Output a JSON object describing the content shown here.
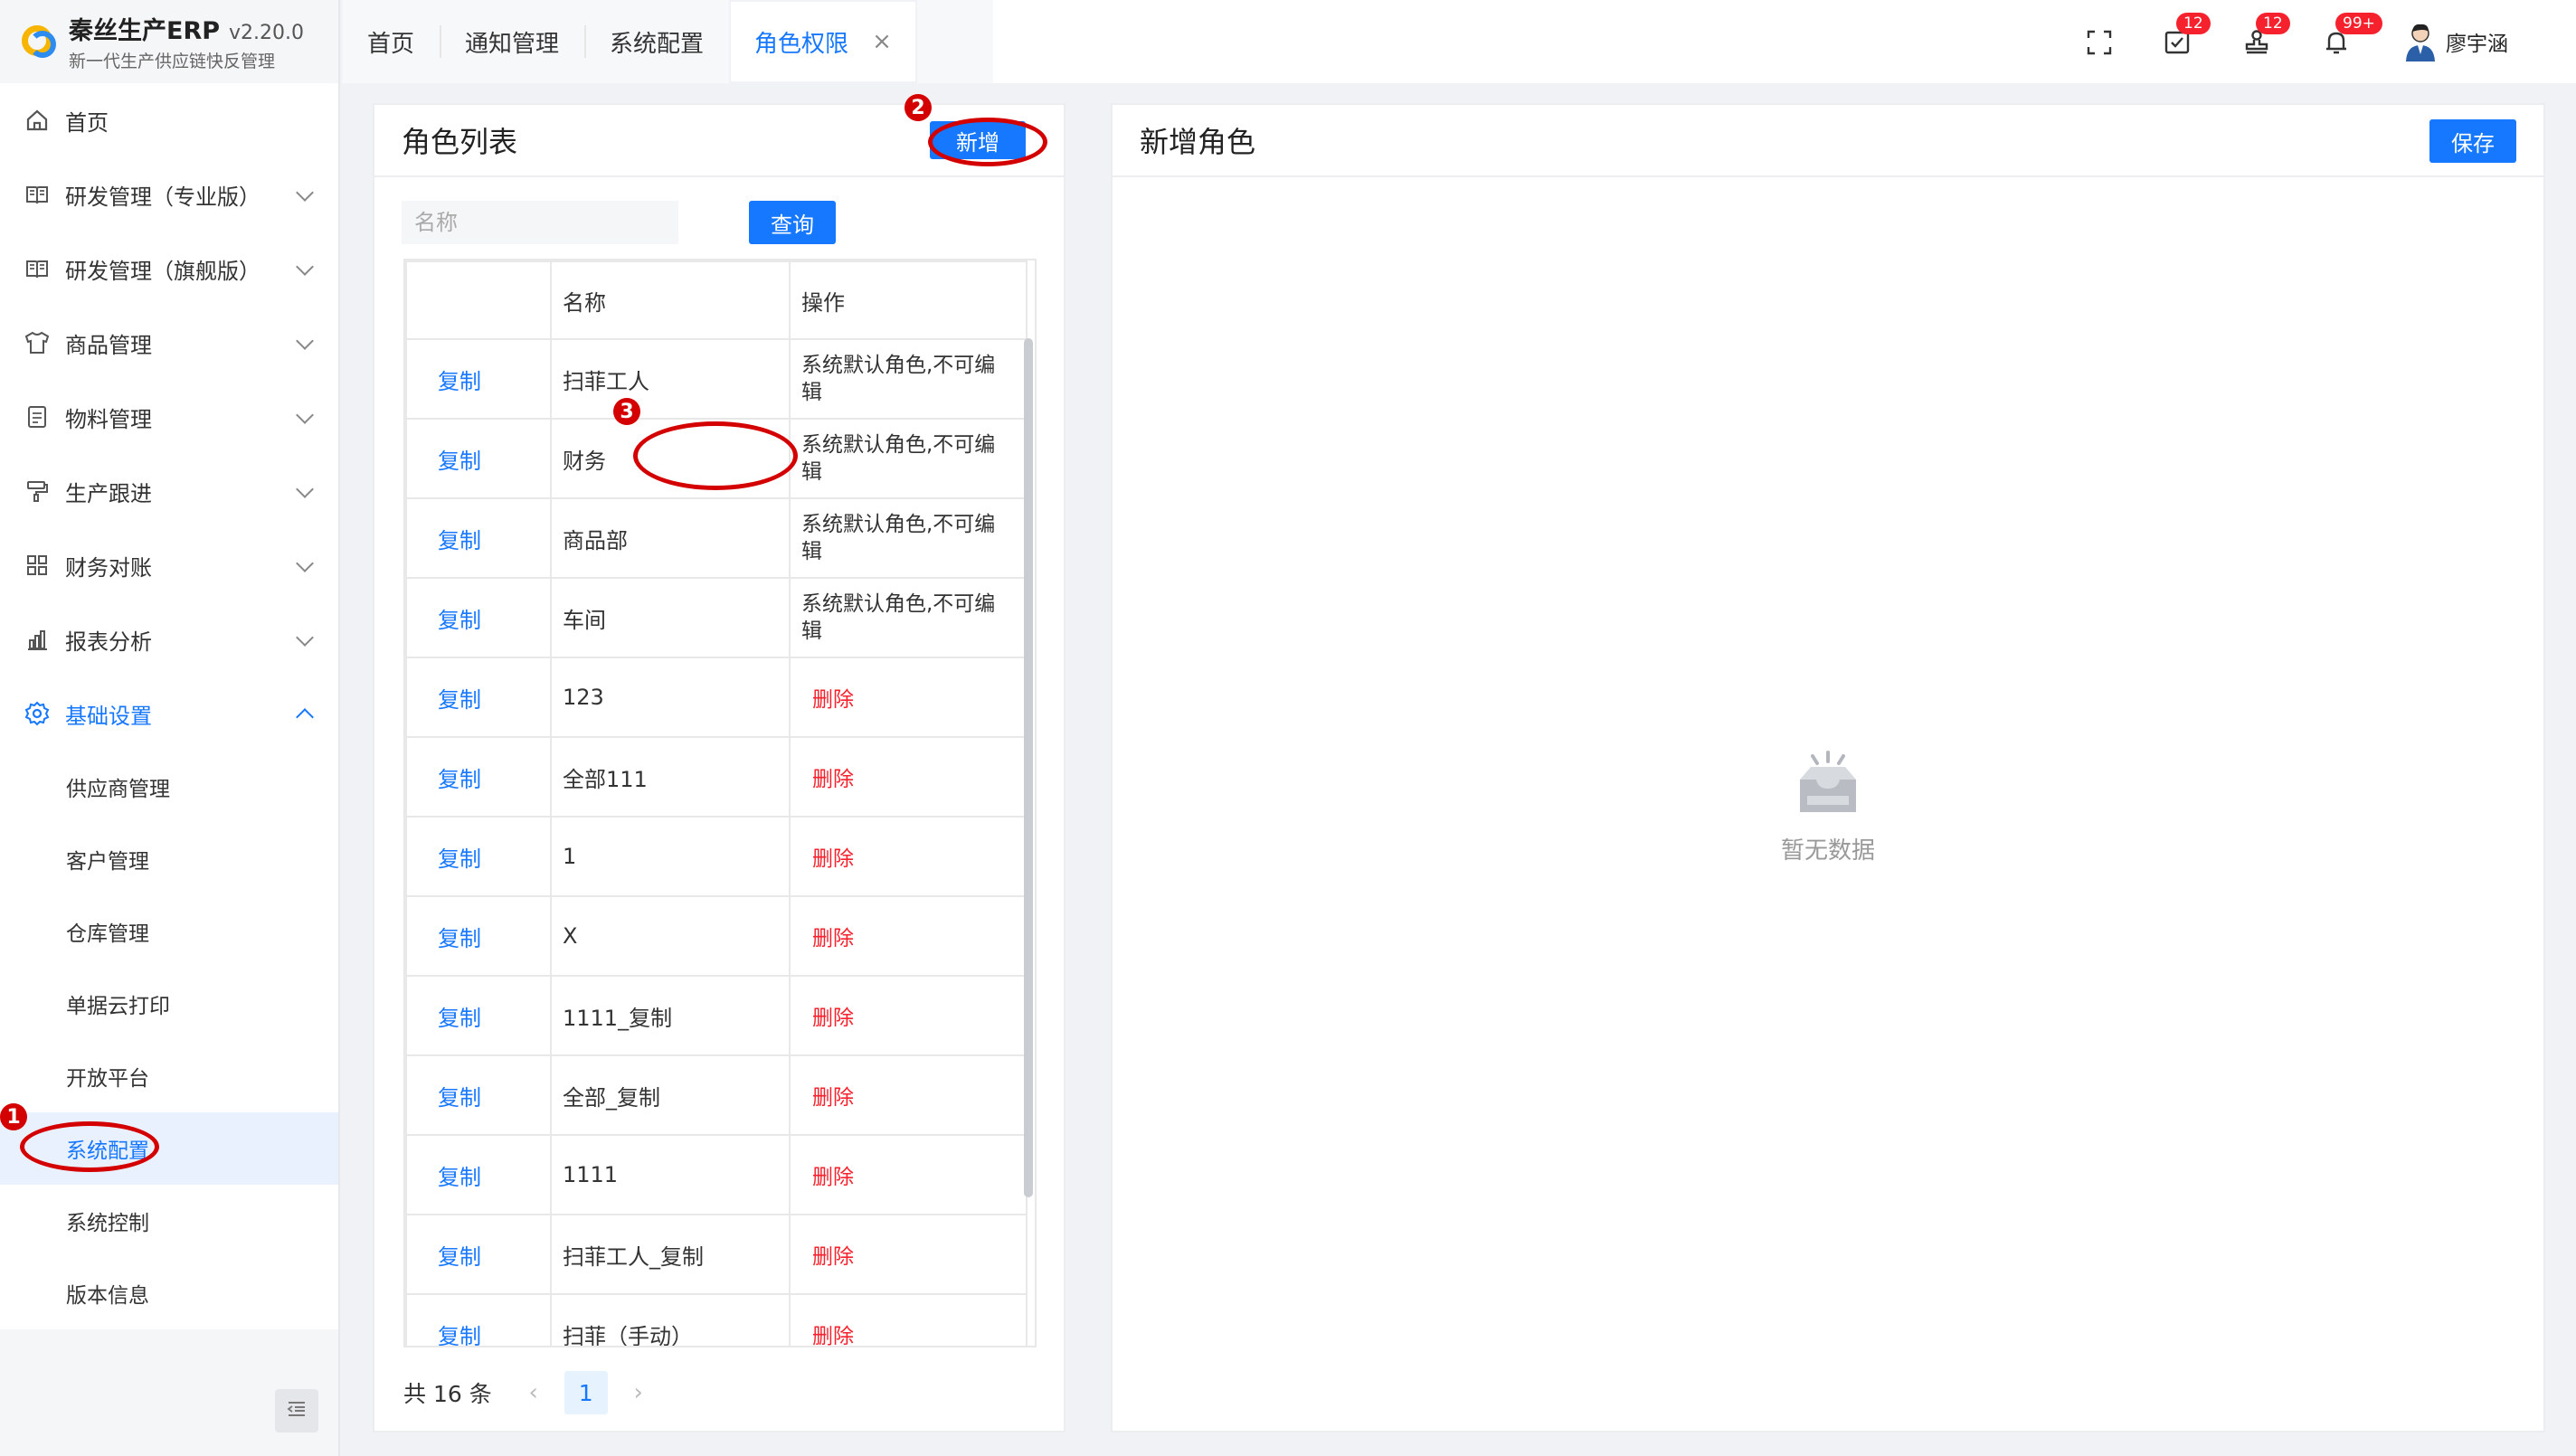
{
  "brand": {
    "name": "秦丝生产ERP",
    "version": "v2.20.0",
    "subtitle": "新一代生产供应链快反管理"
  },
  "sidebar": {
    "items": [
      {
        "label": "首页",
        "icon": "home-icon"
      },
      {
        "label": "研发管理（专业版）",
        "icon": "book-icon"
      },
      {
        "label": "研发管理（旗舰版）",
        "icon": "book-icon"
      },
      {
        "label": "商品管理",
        "icon": "shirt-icon"
      },
      {
        "label": "物料管理",
        "icon": "document-icon"
      },
      {
        "label": "生产跟进",
        "icon": "roller-icon"
      },
      {
        "label": "财务对账",
        "icon": "grid-icon"
      },
      {
        "label": "报表分析",
        "icon": "bar-chart-icon"
      },
      {
        "label": "基础设置",
        "icon": "gear-icon"
      }
    ],
    "submenu": [
      {
        "label": "供应商管理"
      },
      {
        "label": "客户管理"
      },
      {
        "label": "仓库管理"
      },
      {
        "label": "单据云打印"
      },
      {
        "label": "开放平台"
      },
      {
        "label": "系统配置"
      },
      {
        "label": "系统控制"
      },
      {
        "label": "版本信息"
      }
    ]
  },
  "tabs": [
    {
      "label": "首页"
    },
    {
      "label": "通知管理"
    },
    {
      "label": "系统配置"
    },
    {
      "label": "角色权限",
      "close": "×"
    }
  ],
  "header": {
    "badges": {
      "tasks": "12",
      "stamps": "12",
      "notifications": "99+"
    },
    "user": "廖宇涵"
  },
  "role_list": {
    "title": "角色列表",
    "add_label": "新增",
    "search_placeholder": "名称",
    "query_label": "查询",
    "columns": [
      "",
      "名称",
      "操作"
    ],
    "rows": [
      {
        "action": "复制",
        "name": "扫菲工人",
        "op": "系统默认角色,不可编辑",
        "type": "sys"
      },
      {
        "action": "复制",
        "name": "财务",
        "op": "系统默认角色,不可编辑",
        "type": "sys"
      },
      {
        "action": "复制",
        "name": "商品部",
        "op": "系统默认角色,不可编辑",
        "type": "sys"
      },
      {
        "action": "复制",
        "name": "车间",
        "op": "系统默认角色,不可编辑",
        "type": "sys"
      },
      {
        "action": "复制",
        "name": "123",
        "op": "删除",
        "type": "del"
      },
      {
        "action": "复制",
        "name": "全部111",
        "op": "删除",
        "type": "del"
      },
      {
        "action": "复制",
        "name": "1",
        "op": "删除",
        "type": "del"
      },
      {
        "action": "复制",
        "name": "X",
        "op": "删除",
        "type": "del"
      },
      {
        "action": "复制",
        "name": "1111_复制",
        "op": "删除",
        "type": "del"
      },
      {
        "action": "复制",
        "name": "全部_复制",
        "op": "删除",
        "type": "del"
      },
      {
        "action": "复制",
        "name": "1111",
        "op": "删除",
        "type": "del"
      },
      {
        "action": "复制",
        "name": "扫菲工人_复制",
        "op": "删除",
        "type": "del"
      },
      {
        "action": "复制",
        "name": "扫菲（手动）",
        "op": "删除",
        "type": "del"
      }
    ],
    "pager": {
      "total": "共 16 条",
      "page": "1",
      "prev": "‹",
      "next": "›"
    }
  },
  "new_role": {
    "title": "新增角色",
    "save_label": "保存",
    "empty_text": "暂无数据"
  },
  "annotations": {
    "one": "1",
    "two": "2",
    "three": "3"
  },
  "colors": {
    "primary": "#1677ff",
    "danger": "#f5222d",
    "annotation": "#d40000"
  }
}
